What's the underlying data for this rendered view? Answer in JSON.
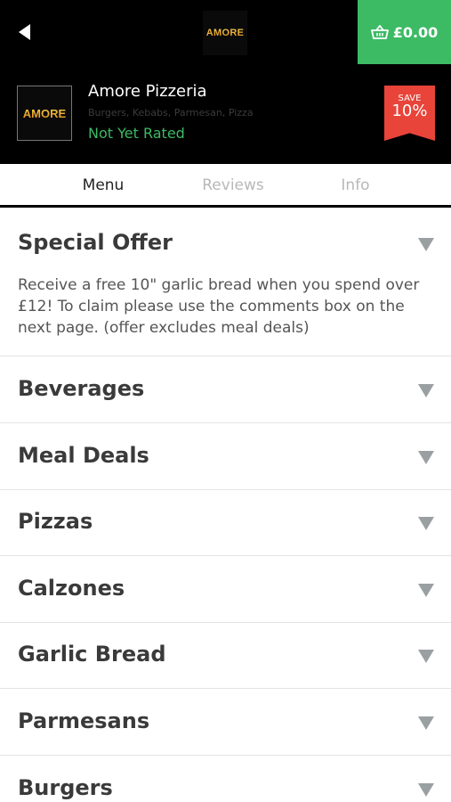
{
  "header": {
    "back_icon": "back-arrow-icon",
    "logo_text": "AMORE",
    "cart_icon": "basket-icon",
    "cart_total": "£0.00"
  },
  "restaurant": {
    "logo_text": "AMORE",
    "name": "Amore Pizzeria",
    "cuisines": "Burgers, Kebabs, Parmesan, Pizza",
    "rating": "Not Yet Rated",
    "save_label": "SAVE",
    "save_value": "10%"
  },
  "tabs": [
    "Menu",
    "Reviews",
    "Info"
  ],
  "special_offer": {
    "title": "Special Offer",
    "text": "Receive a free 10\" garlic bread when you spend over £12! To claim please use the comments box on the next page. (offer excludes meal deals)"
  },
  "categories": [
    "Beverages",
    "Meal Deals",
    "Pizzas",
    "Calzones",
    "Garlic Bread",
    "Parmesans",
    "Burgers"
  ],
  "colors": {
    "accent_green": "#3cba64",
    "badge_red": "#e8443a",
    "header_bg": "#000000",
    "caret_grey": "#9aa0a2"
  }
}
